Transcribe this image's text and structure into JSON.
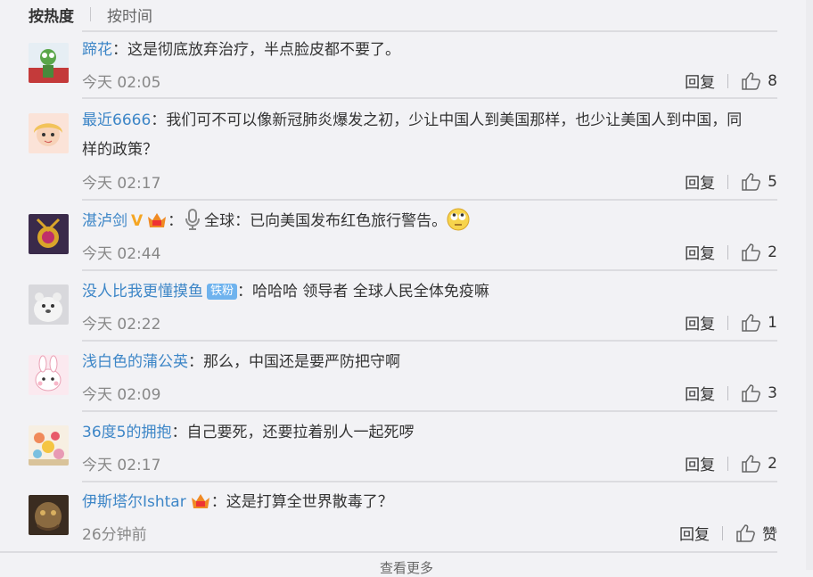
{
  "sort": {
    "hot": "按热度",
    "time": "按时间"
  },
  "comments": [
    {
      "user": "蹄花",
      "text": "：这是彻底放弃治疗，半点脸皮都不要了。",
      "time": "今天 02:05",
      "reply": "回复",
      "likes": "8"
    },
    {
      "user": "最近6666",
      "text": "：我们可不可以像新冠肺炎爆发之初，少让中国人到美国那样，也少让美国人到中国，同",
      "text2": "样的政策？",
      "time": "今天 02:17",
      "reply": "回复",
      "likes": "5"
    },
    {
      "user": "湛泸剑",
      "text_pre": "：",
      "text": "全球：已向美国发布红色旅行警告。",
      "time": "今天 02:44",
      "reply": "回复",
      "likes": "2"
    },
    {
      "user": "没人比我更懂摸鱼",
      "tag": "铁粉",
      "text": "：哈哈哈 领导者 全球人民全体免疫嘛",
      "time": "今天 02:22",
      "reply": "回复",
      "likes": "1"
    },
    {
      "user": "浅白色的蒲公英",
      "text": "：那么，中国还是要严防把守啊",
      "time": "今天 02:09",
      "reply": "回复",
      "likes": "3"
    },
    {
      "user": "36度5的拥抱",
      "text": "：自己要死，还要拉着别人一起死啰",
      "time": "今天 02:17",
      "reply": "回复",
      "likes": "2"
    },
    {
      "user": "伊斯塔尔Ishtar",
      "text": "：这是打算全世界散毒了？",
      "time": "26分钟前",
      "reply": "回复",
      "likes": "赞"
    }
  ],
  "more": "查看更多"
}
